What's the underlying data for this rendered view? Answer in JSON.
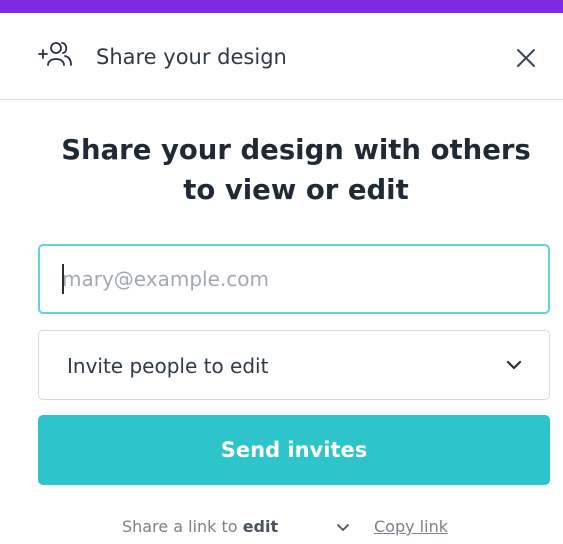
{
  "header": {
    "title": "Share your design",
    "icon": "add-people-icon",
    "close_icon": "close-icon"
  },
  "heading": {
    "line1": "Share your design with others",
    "line2": "to view or edit"
  },
  "email_input": {
    "placeholder": "mary@example.com",
    "value": ""
  },
  "permission_select": {
    "selected": "Invite people to edit",
    "icon": "chevron-down-icon"
  },
  "send_button": {
    "label": "Send invites"
  },
  "footer": {
    "share_prefix": "Share a link to ",
    "share_mode": "edit",
    "copy_link": "Copy link"
  },
  "colors": {
    "accent_bar": "#7d2ae8",
    "primary_button": "#2ec4cc",
    "focus_border": "#5fd3dc"
  }
}
